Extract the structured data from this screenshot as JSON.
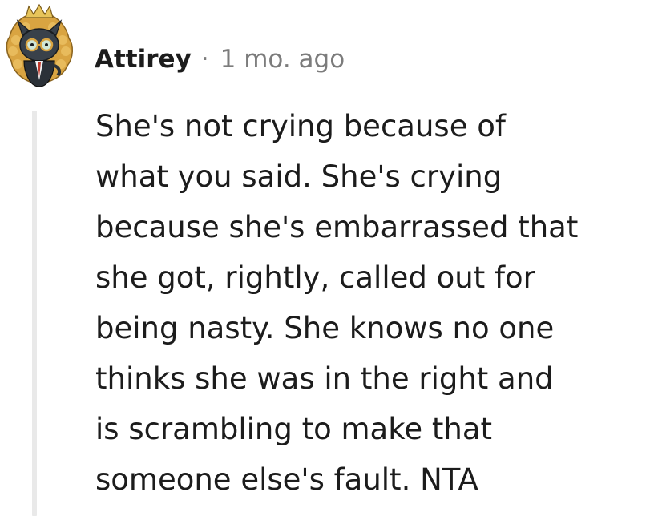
{
  "comment": {
    "author": "Attirey",
    "separator": "·",
    "timestamp": "1 mo. ago",
    "body": "She's not crying because of\nwhat you said. She's crying\nbecause she's embarrassed that\nshe got, rightly, called out for\nbeing nasty. She knows no one\nthinks she was in the right and\nis scrambling to make that\nsomeone else's fault. NTA",
    "avatar_icon": "snoo-avatar-icon"
  },
  "colors": {
    "text": "#1c1c1c",
    "meta_gray": "#7c7c7c",
    "thread_line": "#e9e9e9",
    "avatar_gold": "#d9a441",
    "avatar_dark": "#2b3138"
  }
}
